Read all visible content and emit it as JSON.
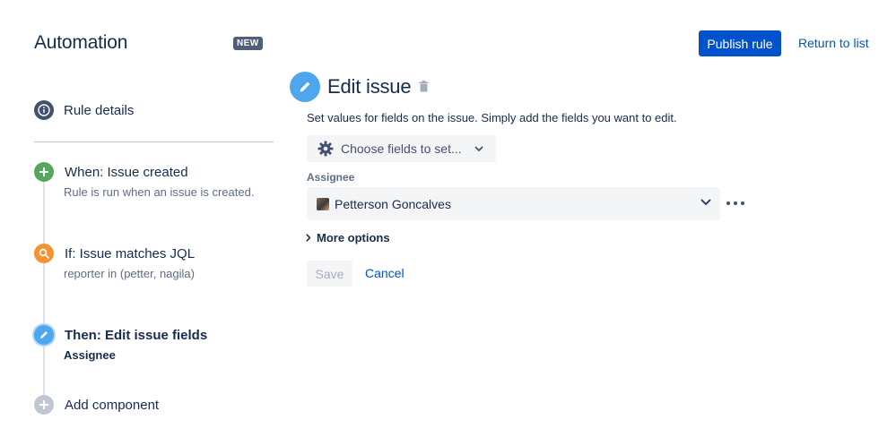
{
  "header": {
    "app_title": "Automation",
    "new_badge": "NEW",
    "publish_label": "Publish rule",
    "return_label": "Return to list"
  },
  "sidebar": {
    "rule_details": "Rule details",
    "steps": [
      {
        "title": "When: Issue created",
        "subtitle": "Rule is run when an issue is created.",
        "color": "#57a55a",
        "icon": "plus-icon"
      },
      {
        "title": "If: Issue matches JQL",
        "subtitle": "reporter in (petter, nagila)",
        "color": "#f79232",
        "icon": "search-icon"
      },
      {
        "title": "Then: Edit issue fields",
        "subtitle": "Assignee",
        "color": "#4ea6ef",
        "icon": "pencil-icon"
      }
    ],
    "add_component": "Add component"
  },
  "panel": {
    "title": "Edit issue",
    "description": "Set values for fields on the issue. Simply add the fields you want to edit.",
    "choose_fields": "Choose fields to set...",
    "assignee_label": "Assignee",
    "assignee_value": "Petterson Goncalves",
    "more_options": "More options",
    "save_label": "Save",
    "cancel_label": "Cancel"
  },
  "colors": {
    "primary": "#0052cc",
    "text": "#172b4d",
    "subtle": "#5e6c84",
    "field_bg": "#f4f5f7"
  }
}
